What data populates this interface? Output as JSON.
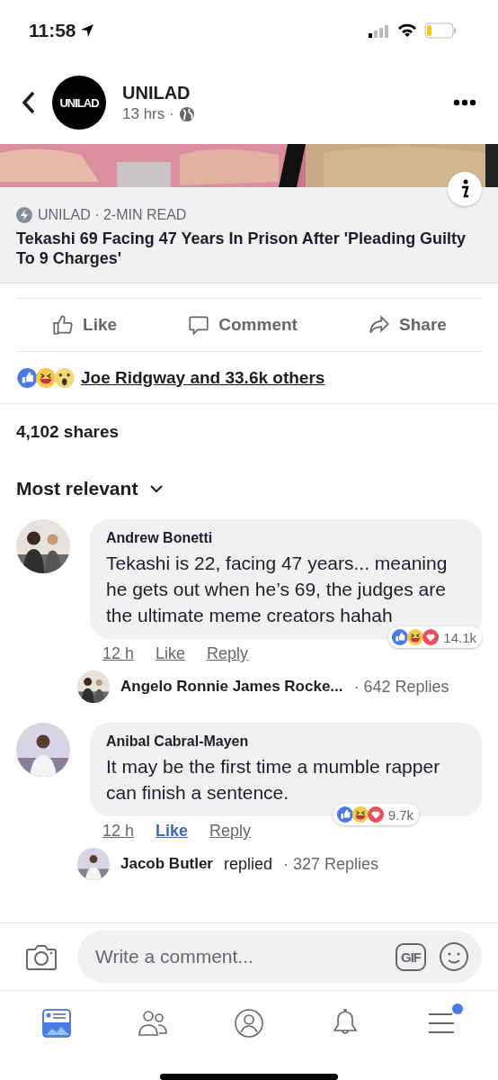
{
  "status_bar": {
    "time": "11:58"
  },
  "header": {
    "logo_text": "UNILAD",
    "page_name": "UNILAD",
    "meta": "13 hrs ·"
  },
  "link_card": {
    "kind": "picture",
    "source": "UNILAD · 2-MIN READ",
    "title": "Tekashi 69 Facing 47 Years In Prison After 'Pleading Guilty To 9 Charges'"
  },
  "actions": [
    {
      "kind": "like",
      "label": "Like"
    },
    {
      "kind": "comment",
      "label": "Comment"
    },
    {
      "kind": "share",
      "label": "Share"
    }
  ],
  "reactions_summary": "Joe Ridgway and 33.6k others",
  "shares": "4,102 shares",
  "sort": "Most relevant",
  "comments": [
    {
      "author": "Andrew Bonetti",
      "text": "Tekashi is 22, facing 47 years... meaning he gets out when he’s 69, the judges are the ultimate meme creators hahah",
      "time": "12 h",
      "like": {
        "label": "Like",
        "selected": false
      },
      "reply": "Reply",
      "reaction_count": "14.1k",
      "reply_preview": {
        "name": "Angelo Ronnie James Rocke...",
        "replies": "· 642 Replies"
      }
    },
    {
      "author": "Anibal Cabral-Mayen",
      "text": "It may be the first time a mumble rapper can finish a sentence.",
      "time": "12 h",
      "like": {
        "label": "Like",
        "selected": true
      },
      "reply": "Reply",
      "reaction_count": "9.7k",
      "reply_preview": {
        "name": "Jacob Butler",
        "verb": "replied",
        "replies": "· 327 Replies"
      }
    }
  ],
  "composer": {
    "placeholder": "Write a comment...",
    "gif": "GIF"
  },
  "nav": [
    {
      "kind": "feed",
      "selected": true,
      "badge": false
    },
    {
      "kind": "friends",
      "selected": false,
      "badge": false
    },
    {
      "kind": "profile",
      "selected": false,
      "badge": false
    },
    {
      "kind": "bell",
      "selected": false,
      "badge": false
    },
    {
      "kind": "menu",
      "selected": false,
      "badge": true
    }
  ]
}
